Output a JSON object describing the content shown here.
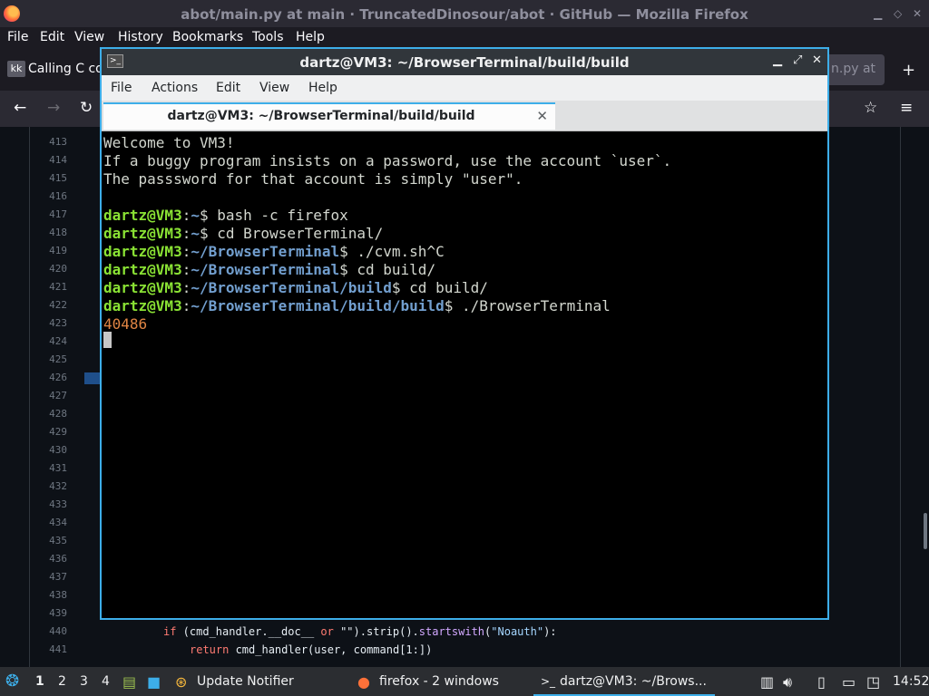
{
  "firefox": {
    "window_title": "abot/main.py at main · TruncatedDinosour/abot · GitHub — Mozilla Firefox",
    "menu": [
      "File",
      "Edit",
      "View",
      "History",
      "Bookmarks",
      "Tools",
      "Help"
    ],
    "tabs": [
      {
        "favicon": "kk",
        "title": "Calling C co"
      },
      {
        "title": "n.py at"
      }
    ]
  },
  "github": {
    "line_numbers": [
      "413",
      "414",
      "415",
      "416",
      "417",
      "418",
      "419",
      "420",
      "421",
      "422",
      "423",
      "424",
      "425",
      "426",
      "427",
      "428",
      "429",
      "430",
      "431",
      "432",
      "433",
      "434",
      "435",
      "436",
      "437",
      "438",
      "439",
      "440",
      "441"
    ],
    "code": {
      "l440_kw1": "if",
      "l440_a": " (cmd_handler.__doc__ ",
      "l440_kw2": "or",
      "l440_b": " \"\").strip().",
      "l440_fn": "startswith",
      "l440_c": "(",
      "l440_str": "\"Noauth\"",
      "l440_d": "):",
      "l441_kw": "return",
      "l441_a": " cmd_handler(user, command[1:])"
    }
  },
  "terminal": {
    "window_title": "dartz@VM3: ~/BrowserTerminal/build/build",
    "menu": [
      "File",
      "Actions",
      "Edit",
      "View",
      "Help"
    ],
    "tab_title": "dartz@VM3: ~/BrowserTerminal/build/build",
    "welcome": [
      "Welcome to VM3!",
      "If a buggy program insists on a password, use the account `user`.",
      "The passsword for that account is simply \"user\"."
    ],
    "user_host": "dartz@VM3",
    "commands": [
      {
        "path": "~",
        "cmd": "$ bash -c firefox"
      },
      {
        "path": "~",
        "cmd": "$ cd BrowserTerminal/"
      },
      {
        "path": "~/BrowserTerminal",
        "cmd": "$ ./cvm.sh^C"
      },
      {
        "path": "~/BrowserTerminal",
        "cmd": "$ cd build/"
      },
      {
        "path": "~/BrowserTerminal/build",
        "cmd": "$ cd build/"
      },
      {
        "path": "~/BrowserTerminal/build/build",
        "cmd": "$ ./BrowserTerminal"
      }
    ],
    "output": "40486"
  },
  "taskbar": {
    "desktops": [
      "1",
      "2",
      "3",
      "4"
    ],
    "update_notifier": "Update Notifier",
    "firefox_item": "firefox - 2 windows",
    "terminal_item": "dartz@VM3: ~/Brows...",
    "clock": "14:52"
  }
}
